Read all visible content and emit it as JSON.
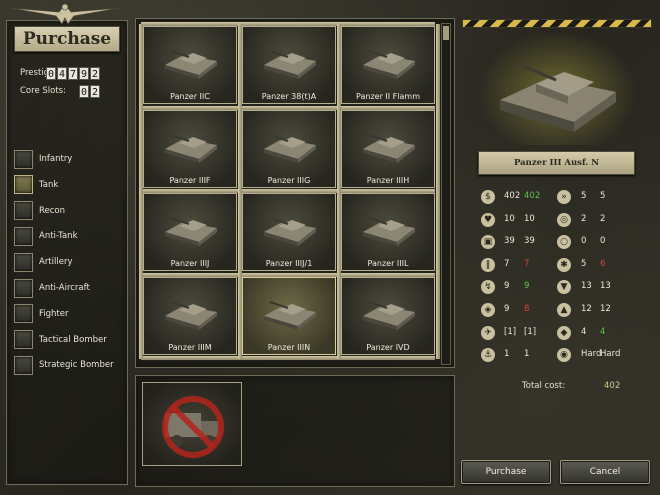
{
  "left": {
    "title": "Purchase",
    "prestige_label": "Prestige:",
    "prestige_digits": [
      "0",
      "4",
      "7",
      "9",
      "2"
    ],
    "core_label": "Core Slots:",
    "core_digits": [
      "0",
      "2"
    ],
    "categories": [
      {
        "label": "Infantry",
        "selected": false
      },
      {
        "label": "Tank",
        "selected": true
      },
      {
        "label": "Recon",
        "selected": false
      },
      {
        "label": "Anti-Tank",
        "selected": false
      },
      {
        "label": "Artillery",
        "selected": false
      },
      {
        "label": "Anti-Aircraft",
        "selected": false
      },
      {
        "label": "Fighter",
        "selected": false
      },
      {
        "label": "Tactical Bomber",
        "selected": false
      },
      {
        "label": "Strategic Bomber",
        "selected": false
      }
    ]
  },
  "units": [
    {
      "name": "Panzer IIC",
      "selected": false
    },
    {
      "name": "Panzer 38(t)A",
      "selected": false
    },
    {
      "name": "Panzer II Flamm",
      "selected": false
    },
    {
      "name": "Panzer IIIF",
      "selected": false
    },
    {
      "name": "Panzer IIIG",
      "selected": false
    },
    {
      "name": "Panzer IIIH",
      "selected": false
    },
    {
      "name": "Panzer IIIJ",
      "selected": false
    },
    {
      "name": "Panzer IIIJ/1",
      "selected": false
    },
    {
      "name": "Panzer IIIL",
      "selected": false
    },
    {
      "name": "Panzer IIIM",
      "selected": false
    },
    {
      "name": "Panzer IIIN",
      "selected": true
    },
    {
      "name": "Panzer IVD",
      "selected": false
    }
  ],
  "transport": {
    "icon": "no-transport-icon"
  },
  "detail": {
    "unit_name": "Panzer III Ausf. N",
    "stats": [
      {
        "icon1": "cost-icon",
        "v1": "402",
        "v2": "402",
        "v2_color": "green",
        "icon2": "move-icon",
        "v3": "5",
        "v4": "5",
        "v4_color": ""
      },
      {
        "icon1": "strength-icon",
        "v1": "10",
        "v2": "10",
        "v2_color": "",
        "icon2": "spotting-icon",
        "v3": "2",
        "v4": "2",
        "v4_color": ""
      },
      {
        "icon1": "fuel-icon",
        "v1": "39",
        "v2": "39",
        "v2_color": "",
        "icon2": "range-icon",
        "v3": "0",
        "v4": "0",
        "v4_color": ""
      },
      {
        "icon1": "ammo-icon",
        "v1": "7",
        "v2": "7",
        "v2_color": "red",
        "icon2": "soft-attack-icon",
        "v3": "5",
        "v4": "6",
        "v4_color": "red"
      },
      {
        "icon1": "initiative-icon",
        "v1": "9",
        "v2": "9",
        "v2_color": "green",
        "icon2": "ground-defense-icon",
        "v3": "13",
        "v4": "13",
        "v4_color": ""
      },
      {
        "icon1": "hard-attack-icon",
        "v1": "9",
        "v2": "8",
        "v2_color": "red",
        "icon2": "air-defense-icon",
        "v3": "12",
        "v4": "12",
        "v4_color": ""
      },
      {
        "icon1": "air-attack-icon",
        "v1": "[1]",
        "v2": "[1]",
        "v2_color": "",
        "icon2": "close-defense-icon",
        "v3": "4",
        "v4": "4",
        "v4_color": "green"
      },
      {
        "icon1": "naval-attack-icon",
        "v1": "1",
        "v2": "1",
        "v2_color": "",
        "icon2": "target-type-icon",
        "v3": "Hard",
        "v4": "Hard",
        "v4_color": ""
      }
    ],
    "total_label": "Total cost:",
    "total_value": "402"
  },
  "buttons": {
    "purchase": "Purchase",
    "cancel": "Cancel"
  },
  "colors": {
    "accent": "#d9b84c",
    "green": "#5fc24c",
    "red": "#d0463a"
  }
}
